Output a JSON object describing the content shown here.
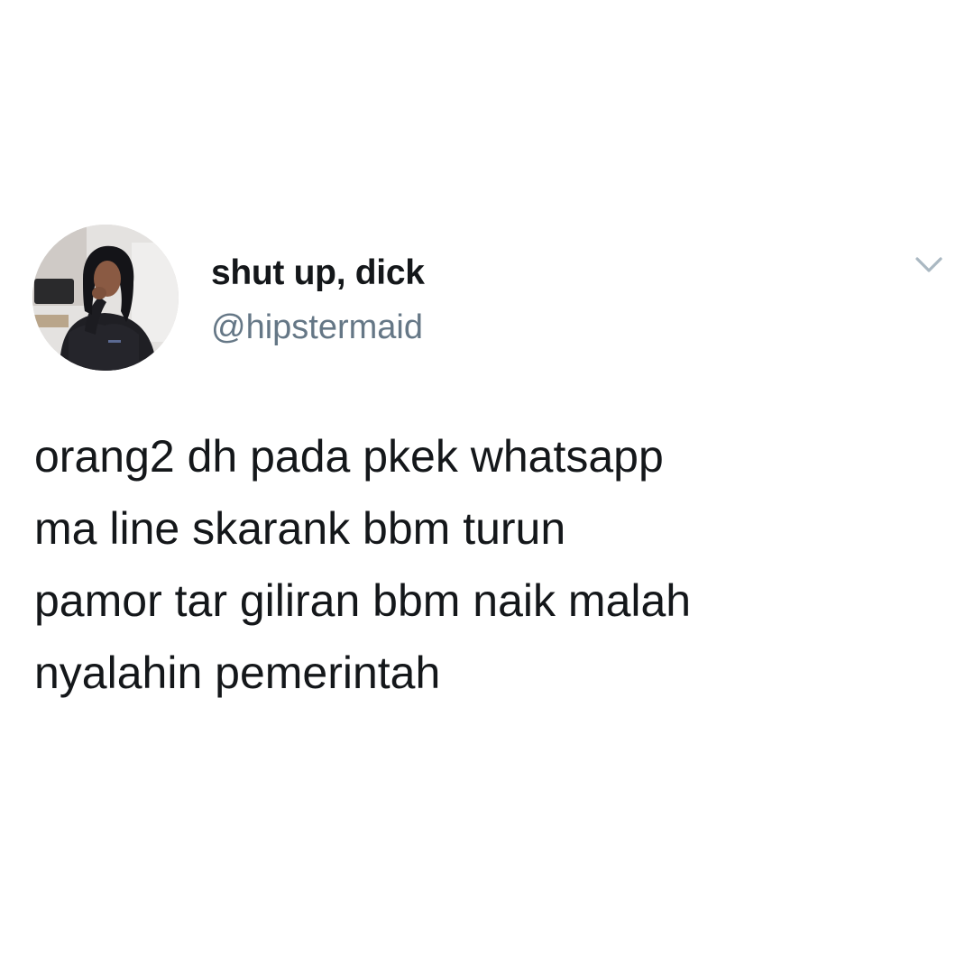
{
  "tweet": {
    "author": {
      "display_name": "shut up, dick",
      "handle": "@hipstermaid",
      "avatar_icon": "profile-photo"
    },
    "menu_icon": "chevron-down-icon",
    "text_lines": [
      "orang2 dh pada pkek whatsapp",
      "ma line skarank bbm turun",
      "pamor tar giliran bbm naik malah",
      "nyalahin pemerintah"
    ]
  },
  "colors": {
    "background": "#ffffff",
    "text_primary": "#14171a",
    "text_secondary": "#657786",
    "chevron": "#aab8c2"
  }
}
